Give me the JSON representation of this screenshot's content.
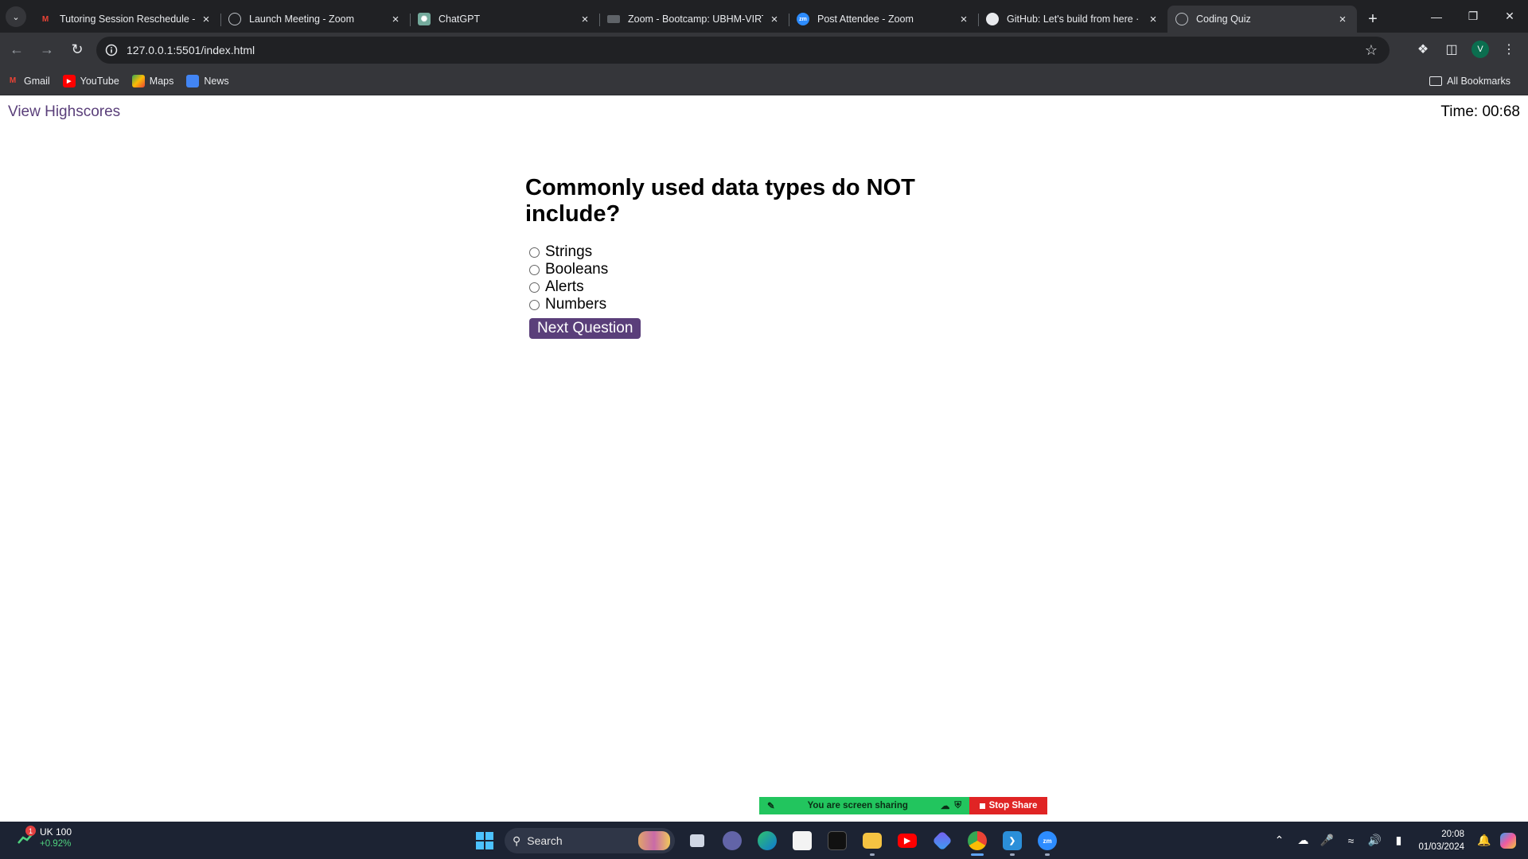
{
  "browser": {
    "tabs": [
      {
        "title": "Tutoring Session Reschedule - ",
        "icon": "gmail-icon",
        "active": false
      },
      {
        "title": "Launch Meeting - Zoom",
        "icon": "globe-icon",
        "active": false
      },
      {
        "title": "ChatGPT",
        "icon": "chatgpt-icon",
        "active": false
      },
      {
        "title": "Zoom - Bootcamp: UBHM-VIRT",
        "icon": "page-icon",
        "active": false
      },
      {
        "title": "Post Attendee - Zoom",
        "icon": "zoom-icon",
        "active": false
      },
      {
        "title": "GitHub: Let's build from here · ",
        "icon": "github-icon",
        "active": false
      },
      {
        "title": "Coding Quiz",
        "icon": "globe-icon",
        "active": true
      }
    ],
    "url": "127.0.0.1:5501/index.html",
    "profile_initial": "V",
    "bookmarks": [
      {
        "label": "Gmail",
        "icon": "gmail-icon"
      },
      {
        "label": "YouTube",
        "icon": "youtube-icon"
      },
      {
        "label": "Maps",
        "icon": "maps-icon"
      },
      {
        "label": "News",
        "icon": "news-icon"
      }
    ],
    "all_bookmarks": "All Bookmarks"
  },
  "page": {
    "highscores_link": "View Highscores",
    "timer": "Time: 00:68",
    "question": "Commonly used data types do NOT include?",
    "choices": [
      "Strings",
      "Booleans",
      "Alerts",
      "Numbers"
    ],
    "next_button": "Next Question"
  },
  "share_bar": {
    "status": "You are screen sharing",
    "stop": "Stop Share"
  },
  "taskbar": {
    "stock_name": "UK 100",
    "stock_change": "+0.92%",
    "stock_badge": "1",
    "search_label": "Search",
    "time": "20:08",
    "date": "01/03/2024"
  },
  "colors": {
    "accent": "#5a3f7a",
    "share_green": "#22c55e",
    "share_red": "#e02424"
  }
}
